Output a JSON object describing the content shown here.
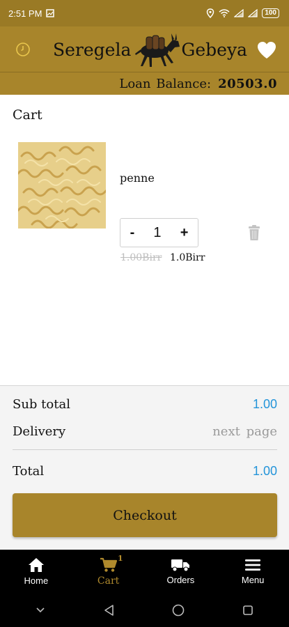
{
  "status_bar": {
    "time": "2:51 PM",
    "battery": "100"
  },
  "header": {
    "brand_left": "Seregela",
    "brand_right": "Gebeya"
  },
  "loan": {
    "label": "Loan Balance:",
    "value": "20503.0"
  },
  "cart": {
    "title": "Cart",
    "items": [
      {
        "name": "penne",
        "quantity": "1",
        "minus_label": "-",
        "plus_label": "+",
        "old_price": "1.00Birr",
        "price": "1.0Birr"
      }
    ]
  },
  "summary": {
    "subtotal_label": "Sub total",
    "subtotal_value": "1.00",
    "delivery_label": "Delivery",
    "delivery_value": "next page",
    "total_label": "Total",
    "total_value": "1.00",
    "checkout_label": "Checkout"
  },
  "nav": {
    "items": [
      {
        "label": "Home",
        "icon": "home-icon"
      },
      {
        "label": "Cart",
        "icon": "cart-icon",
        "badge": "1",
        "active": true
      },
      {
        "label": "Orders",
        "icon": "truck-icon"
      },
      {
        "label": "Menu",
        "icon": "menu-icon"
      }
    ]
  },
  "colors": {
    "brand": "#a8852b",
    "accent_blue": "#2394d9",
    "nav_active": "#b08a2d"
  }
}
